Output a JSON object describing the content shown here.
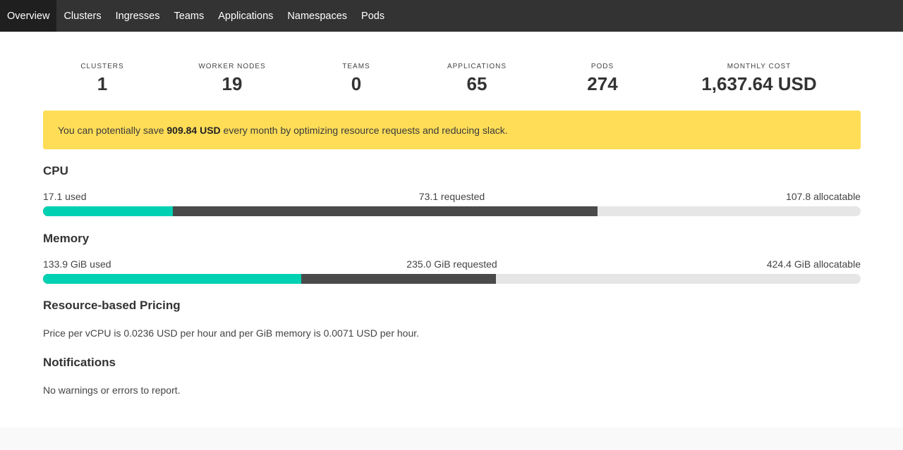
{
  "nav": {
    "items": [
      {
        "label": "Overview",
        "active": true
      },
      {
        "label": "Clusters",
        "active": false
      },
      {
        "label": "Ingresses",
        "active": false
      },
      {
        "label": "Teams",
        "active": false
      },
      {
        "label": "Applications",
        "active": false
      },
      {
        "label": "Namespaces",
        "active": false
      },
      {
        "label": "Pods",
        "active": false
      }
    ]
  },
  "stats": [
    {
      "label": "CLUSTERS",
      "value": "1"
    },
    {
      "label": "WORKER NODES",
      "value": "19"
    },
    {
      "label": "TEAMS",
      "value": "0"
    },
    {
      "label": "APPLICATIONS",
      "value": "65"
    },
    {
      "label": "PODS",
      "value": "274"
    },
    {
      "label": "MONTHLY COST",
      "value": "1,637.64 USD"
    }
  ],
  "alert": {
    "prefix": "You can potentially save ",
    "amount": "909.84 USD",
    "suffix": " every month by optimizing resource requests and reducing slack."
  },
  "cpu": {
    "title": "CPU",
    "used_label": "17.1 used",
    "requested_label": "73.1 requested",
    "allocatable_label": "107.8 allocatable",
    "used": 17.1,
    "requested": 73.1,
    "allocatable": 107.8
  },
  "memory": {
    "title": "Memory",
    "used_label": "133.9 GiB used",
    "requested_label": "235.0 GiB requested",
    "allocatable_label": "424.4 GiB allocatable",
    "used": 133.9,
    "requested": 235.0,
    "allocatable": 424.4
  },
  "pricing": {
    "title": "Resource-based Pricing",
    "text": "Price per vCPU is 0.0236 USD per hour and per GiB memory is 0.0071 USD per hour."
  },
  "notifications": {
    "title": "Notifications",
    "text": "No warnings or errors to report."
  },
  "colors": {
    "navbar": "#333333",
    "used": "#00d1b2",
    "requested": "#4a4a4a",
    "track": "#e6e6e6",
    "alert": "#ffdd57"
  }
}
